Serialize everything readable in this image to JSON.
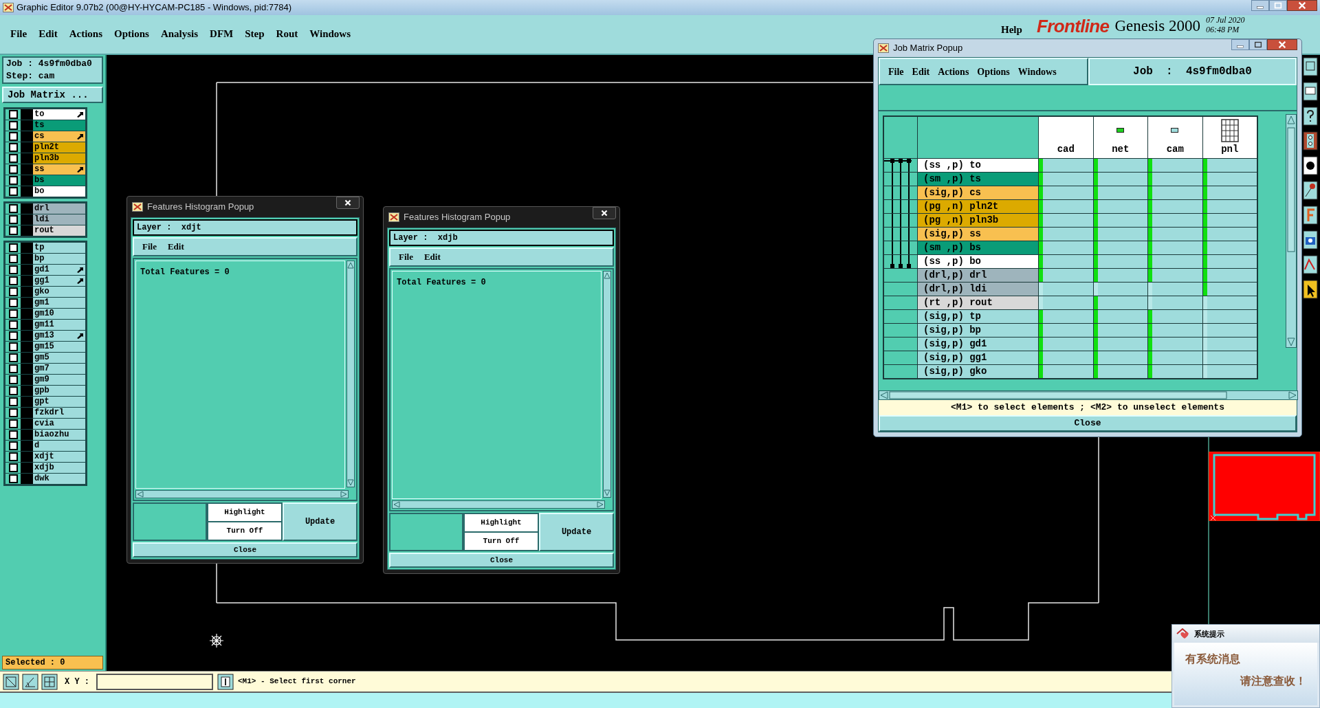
{
  "window": {
    "title": "Graphic Editor 9.07b2 (00@HY-HYCAM-PC185 - Windows, pid:7784)"
  },
  "menu": [
    "File",
    "Edit",
    "Actions",
    "Options",
    "Analysis",
    "DFM",
    "Step",
    "Rout",
    "Windows"
  ],
  "help_menu": "Help",
  "brand": {
    "logo": "Frontline",
    "product": "Genesis 2000",
    "date": "07 Jul 2020",
    "time": "06:48 PM"
  },
  "job_panel": {
    "job": "Job : 4s9fm0dba0",
    "step": "Step: cam",
    "job_matrix_button": "Job Matrix ..."
  },
  "layer_groups": [
    {
      "layers": [
        {
          "name": "to",
          "color": "#ffffff",
          "checked": false,
          "affected": true
        },
        {
          "name": "ts",
          "color": "#0a9c78",
          "checked": false,
          "affected": false
        },
        {
          "name": "cs",
          "color": "#f8c050",
          "checked": false,
          "affected": true
        },
        {
          "name": "pln2t",
          "color": "#dcaa00",
          "checked": false,
          "affected": false
        },
        {
          "name": "pln3b",
          "color": "#dcaa00",
          "checked": false,
          "affected": false
        },
        {
          "name": "ss",
          "color": "#f8c050",
          "checked": false,
          "affected": true
        },
        {
          "name": "bs",
          "color": "#0a9c78",
          "checked": false,
          "affected": false
        },
        {
          "name": "bo",
          "color": "#ffffff",
          "checked": false,
          "affected": false
        }
      ]
    },
    {
      "layers": [
        {
          "name": "drl",
          "color": "#9eb4bc",
          "checked": false,
          "affected": false
        },
        {
          "name": "ldi",
          "color": "#9eb4bc",
          "checked": false,
          "affected": false
        },
        {
          "name": "rout",
          "color": "#d8d8d8",
          "checked": false,
          "affected": false
        }
      ]
    },
    {
      "layers": [
        {
          "name": "tp",
          "color": "#9fdcdc",
          "checked": false,
          "affected": false
        },
        {
          "name": "bp",
          "color": "#9fdcdc",
          "checked": false,
          "affected": false
        },
        {
          "name": "gd1",
          "color": "#9fdcdc",
          "checked": false,
          "affected": true
        },
        {
          "name": "gg1",
          "color": "#9fdcdc",
          "checked": false,
          "affected": true
        },
        {
          "name": "gko",
          "color": "#9fdcdc",
          "checked": false,
          "affected": false
        },
        {
          "name": "gm1",
          "color": "#9fdcdc",
          "checked": false,
          "affected": false
        },
        {
          "name": "gm10",
          "color": "#9fdcdc",
          "checked": false,
          "affected": false
        },
        {
          "name": "gm11",
          "color": "#9fdcdc",
          "checked": false,
          "affected": false
        },
        {
          "name": "gm13",
          "color": "#9fdcdc",
          "checked": false,
          "affected": true
        },
        {
          "name": "gm15",
          "color": "#9fdcdc",
          "checked": false,
          "affected": false
        },
        {
          "name": "gm5",
          "color": "#9fdcdc",
          "checked": false,
          "affected": false
        },
        {
          "name": "gm7",
          "color": "#9fdcdc",
          "checked": false,
          "affected": false
        },
        {
          "name": "gm9",
          "color": "#9fdcdc",
          "checked": false,
          "affected": false
        },
        {
          "name": "gpb",
          "color": "#9fdcdc",
          "checked": false,
          "affected": false
        },
        {
          "name": "gpt",
          "color": "#9fdcdc",
          "checked": false,
          "affected": false
        },
        {
          "name": "fzkdrl",
          "color": "#9fdcdc",
          "checked": false,
          "affected": false
        },
        {
          "name": "cvia",
          "color": "#9fdcdc",
          "checked": false,
          "affected": false
        },
        {
          "name": "biaozhu",
          "color": "#9fdcdc",
          "checked": false,
          "affected": false
        },
        {
          "name": "d",
          "color": "#9fdcdc",
          "checked": false,
          "affected": false
        },
        {
          "name": "xdjt",
          "color": "#9fdcdc",
          "checked": false,
          "affected": false
        },
        {
          "name": "xdjb",
          "color": "#9fdcdc",
          "checked": false,
          "affected": false
        },
        {
          "name": "dwk",
          "color": "#9fdcdc",
          "checked": false,
          "affected": false
        }
      ]
    }
  ],
  "selected_count": "Selected : 0",
  "bottom_bar": {
    "xy_label": "X Y :",
    "prompt": "<M1> - Select first corner"
  },
  "histogram_popups": [
    {
      "title": "Features Histogram Popup",
      "layer": "Layer :  xdjt",
      "menu": [
        "File",
        "Edit"
      ],
      "text": "Total Features = 0",
      "highlight": "Highlight",
      "turn_off": "Turn Off",
      "update": "Update",
      "close": "Close"
    },
    {
      "title": "Features Histogram Popup",
      "layer": "Layer :  xdjb",
      "menu": [
        "File",
        "Edit"
      ],
      "text": "Total Features = 0",
      "highlight": "Highlight",
      "turn_off": "Turn Off",
      "update": "Update",
      "close": "Close"
    }
  ],
  "job_matrix": {
    "title": "Job Matrix Popup",
    "menu": [
      "File",
      "Edit",
      "Actions",
      "Options",
      "Windows"
    ],
    "job": "Job  :  4s9fm0dba0",
    "steps": [
      {
        "name": "cad",
        "kind": "plain"
      },
      {
        "name": "net",
        "kind": "net"
      },
      {
        "name": "cam",
        "kind": "cam"
      },
      {
        "name": "pnl",
        "kind": "panel"
      }
    ],
    "rows": [
      {
        "label": "(ss ,p) to",
        "color": "#ffffff",
        "in_span": true,
        "cells": [
          {
            "present": true
          },
          {
            "present": true
          },
          {
            "present": true
          },
          {
            "present": true
          }
        ]
      },
      {
        "label": "(sm ,p) ts",
        "color": "#0a9c78",
        "in_span": true,
        "cells": [
          {
            "present": true
          },
          {
            "present": true
          },
          {
            "present": true
          },
          {
            "present": true
          }
        ]
      },
      {
        "label": "(sig,p) cs",
        "color": "#f8c050",
        "in_span": true,
        "cells": [
          {
            "present": true
          },
          {
            "present": true
          },
          {
            "present": true
          },
          {
            "present": true
          }
        ]
      },
      {
        "label": "(pg ,n) pln2t",
        "color": "#dcaa00",
        "in_span": true,
        "cells": [
          {
            "present": true
          },
          {
            "present": true
          },
          {
            "present": true
          },
          {
            "present": true
          }
        ]
      },
      {
        "label": "(pg ,n) pln3b",
        "color": "#dcaa00",
        "in_span": true,
        "cells": [
          {
            "present": true
          },
          {
            "present": true
          },
          {
            "present": true
          },
          {
            "present": true
          }
        ]
      },
      {
        "label": "(sig,p) ss",
        "color": "#f8c050",
        "in_span": true,
        "cells": [
          {
            "present": true
          },
          {
            "present": true
          },
          {
            "present": true
          },
          {
            "present": true
          }
        ]
      },
      {
        "label": "(sm ,p) bs",
        "color": "#0a9c78",
        "in_span": true,
        "cells": [
          {
            "present": true
          },
          {
            "present": true
          },
          {
            "present": true
          },
          {
            "present": true
          }
        ]
      },
      {
        "label": "(ss ,p) bo",
        "color": "#ffffff",
        "in_span": true,
        "cells": [
          {
            "present": true
          },
          {
            "present": true
          },
          {
            "present": true
          },
          {
            "present": true
          }
        ]
      },
      {
        "label": "(drl,p) drl",
        "color": "#9eb4bc",
        "in_span": false,
        "cells": [
          {
            "present": true
          },
          {
            "present": true
          },
          {
            "present": true
          },
          {
            "present": true
          }
        ]
      },
      {
        "label": "(drl,p) ldi",
        "color": "#9eb4bc",
        "in_span": false,
        "cells": [
          {
            "present": false
          },
          {
            "present": false
          },
          {
            "present": false
          },
          {
            "present": true
          }
        ]
      },
      {
        "label": "(rt ,p) rout",
        "color": "#d8d8d8",
        "in_span": false,
        "cells": [
          {
            "present": false
          },
          {
            "present": true
          },
          {
            "present": false
          },
          {
            "present": false
          }
        ]
      },
      {
        "label": "(sig,p) tp",
        "color": "#9fdcdc",
        "in_span": false,
        "cells": [
          {
            "present": true
          },
          {
            "present": true
          },
          {
            "present": true
          },
          {
            "present": false
          }
        ]
      },
      {
        "label": "(sig,p) bp",
        "color": "#9fdcdc",
        "in_span": false,
        "cells": [
          {
            "present": true
          },
          {
            "present": true
          },
          {
            "present": true
          },
          {
            "present": false
          }
        ]
      },
      {
        "label": "(sig,p) gd1",
        "color": "#9fdcdc",
        "in_span": false,
        "cells": [
          {
            "present": true
          },
          {
            "present": true
          },
          {
            "present": true
          },
          {
            "present": false
          }
        ]
      },
      {
        "label": "(sig,p) gg1",
        "color": "#9fdcdc",
        "in_span": false,
        "cells": [
          {
            "present": true
          },
          {
            "present": true
          },
          {
            "present": true
          },
          {
            "present": false
          }
        ]
      },
      {
        "label": "(sig,p) gko",
        "color": "#9fdcdc",
        "in_span": false,
        "cells": [
          {
            "present": true
          },
          {
            "present": true
          },
          {
            "present": true
          },
          {
            "present": false
          }
        ]
      }
    ],
    "hint": "<M1> to select elements ; <M2> to unselect elements",
    "close": "Close"
  },
  "notification": {
    "title": "系统提示",
    "lines": [
      "有系统消息",
      "请注意查收！"
    ]
  }
}
